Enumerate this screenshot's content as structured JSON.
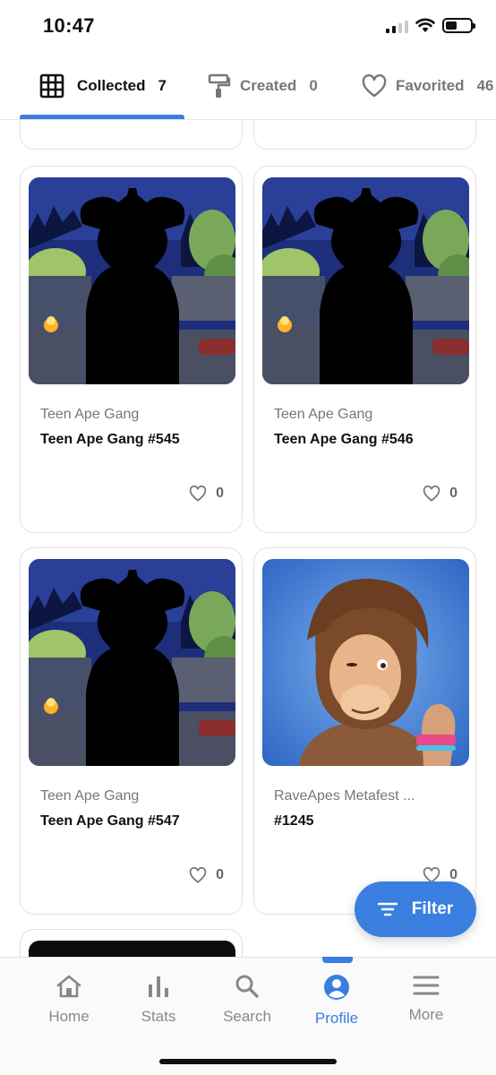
{
  "status_bar": {
    "time": "10:47"
  },
  "tabs": [
    {
      "label": "Collected",
      "count": "7",
      "icon": "grid-icon",
      "active": true
    },
    {
      "label": "Created",
      "count": "0",
      "icon": "paint-roller-icon",
      "active": false
    },
    {
      "label": "Favorited",
      "count": "46",
      "icon": "heart-icon",
      "active": false
    }
  ],
  "cards": [
    {
      "collection": "Teen Ape Gang",
      "name": "Teen Ape Gang #545",
      "likes": "0",
      "image": "hidden-silhouette-scene"
    },
    {
      "collection": "Teen Ape Gang",
      "name": "Teen Ape Gang #546",
      "likes": "0",
      "image": "hidden-silhouette-scene"
    },
    {
      "collection": "Teen Ape Gang",
      "name": "Teen Ape Gang #547",
      "likes": "0",
      "image": "hidden-silhouette-scene"
    },
    {
      "collection": "RaveApes Metafest ...",
      "name": "#1245",
      "likes": "0",
      "image": "ape-portrait"
    }
  ],
  "filter_button": {
    "label": "Filter",
    "icon": "filter-lines-icon"
  },
  "bottom_nav": [
    {
      "label": "Home",
      "icon": "home-icon",
      "active": false
    },
    {
      "label": "Stats",
      "icon": "bar-chart-icon",
      "active": false
    },
    {
      "label": "Search",
      "icon": "search-icon",
      "active": false
    },
    {
      "label": "Profile",
      "icon": "profile-icon",
      "active": true
    },
    {
      "label": "More",
      "icon": "menu-icon",
      "active": false
    }
  ],
  "colors": {
    "accent": "#3a7fe0",
    "text": "#111111",
    "muted": "#777777",
    "border": "#e3e3e3"
  }
}
